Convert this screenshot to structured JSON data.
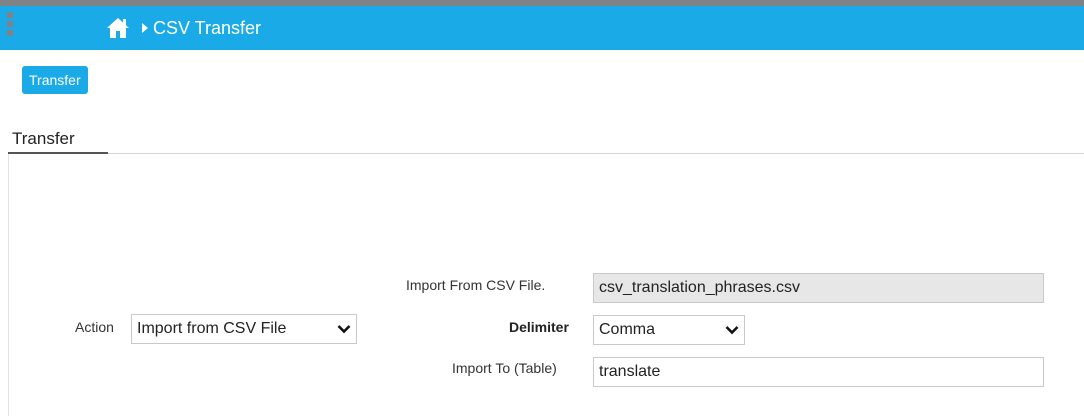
{
  "header": {
    "title": "CSV Transfer",
    "home_icon": "home-icon",
    "separator_icon": "caret-right-icon",
    "grip_icon": "drag-handle-icon",
    "bar_color": "#1aaae8"
  },
  "toolbar": {
    "transfer_label": "Transfer"
  },
  "tabs": [
    {
      "label": "Transfer",
      "active": true
    }
  ],
  "form": {
    "action": {
      "label": "Action",
      "value": "Import from CSV File"
    },
    "import_file": {
      "label": "Import From CSV File.",
      "value": "csv_translation_phrases.csv"
    },
    "delimiter": {
      "label": "Delimiter",
      "value": "Comma"
    },
    "import_to": {
      "label": "Import To (Table)",
      "value": "translate"
    }
  }
}
